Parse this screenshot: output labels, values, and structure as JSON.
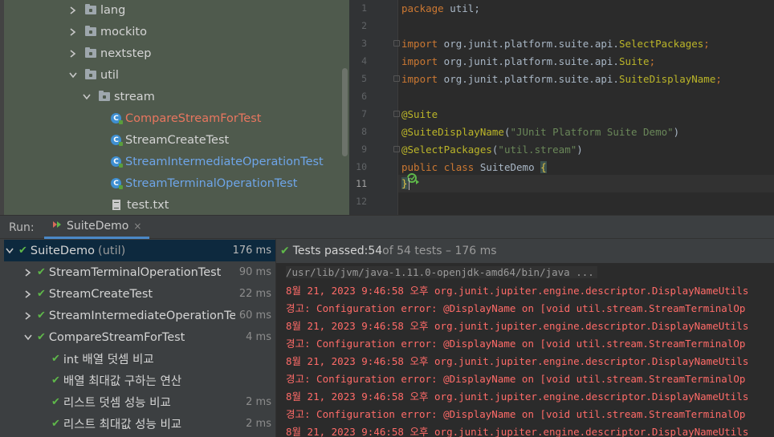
{
  "project_tree": {
    "items": [
      {
        "label": "lang",
        "type": "folder",
        "expanded": false
      },
      {
        "label": "mockito",
        "type": "folder",
        "expanded": false
      },
      {
        "label": "nextstep",
        "type": "folder",
        "expanded": false
      },
      {
        "label": "util",
        "type": "folder",
        "expanded": true
      },
      {
        "label": "stream",
        "type": "folder",
        "expanded": true
      },
      {
        "label": "CompareStreamForTest",
        "type": "class",
        "color": "#e8765f"
      },
      {
        "label": "StreamCreateTest",
        "type": "class",
        "color": "#d4d4d4"
      },
      {
        "label": "StreamIntermediateOperationTest",
        "type": "class",
        "color": "#6ea5e8"
      },
      {
        "label": "StreamTerminalOperationTest",
        "type": "class",
        "color": "#6ea5e8"
      },
      {
        "label": "test.txt",
        "type": "text-file"
      }
    ]
  },
  "editor": {
    "line_numbers": [
      "1",
      "2",
      "3",
      "4",
      "5",
      "6",
      "7",
      "8",
      "9",
      "10",
      "11",
      "12"
    ],
    "lines": {
      "l1": {
        "kw": "package",
        "rest": " util;"
      },
      "l3": {
        "kw": "import",
        "rest": " org.junit.platform.suite.api.",
        "cls": "SelectPackages",
        "end": ";"
      },
      "l4": {
        "kw": "import",
        "rest": " org.junit.platform.suite.api.",
        "cls": "Suite",
        "end": ";"
      },
      "l5": {
        "kw": "import",
        "rest": " org.junit.platform.suite.api.",
        "cls": "SuiteDisplayName",
        "end": ";"
      },
      "l7": {
        "ann": "@Suite"
      },
      "l8": {
        "ann": "@SuiteDisplayName",
        "open": "(",
        "str": "\"JUnit Platform Suite Demo\"",
        "close": ")"
      },
      "l9": {
        "ann": "@SelectPackages",
        "open": "(",
        "str": "\"util.stream\"",
        "close": ")"
      },
      "l10": {
        "kw1": "public",
        "kw2": "class",
        "name": "SuiteDemo",
        "brace": "{"
      },
      "l11": {
        "brace": "}"
      }
    },
    "current_line": "11"
  },
  "run_window": {
    "title": "Run:",
    "tab_label": "SuiteDemo",
    "tab_close": "×"
  },
  "test_tree": {
    "rows": [
      {
        "name": "SuiteDemo",
        "extra": "(util)",
        "time": "176 ms",
        "expand": "down",
        "selected": true
      },
      {
        "name": "StreamTerminalOperationTest",
        "time": "90 ms",
        "expand": "right"
      },
      {
        "name": "StreamCreateTest",
        "time": "22 ms",
        "expand": "right"
      },
      {
        "name": "StreamIntermediateOperationTe",
        "time": "60 ms",
        "expand": "right"
      },
      {
        "name": "CompareStreamForTest",
        "time": "4 ms",
        "expand": "down"
      },
      {
        "name": "int 배열 덧셈 비교",
        "time": ""
      },
      {
        "name": "배열 최대값 구하는 연산",
        "time": ""
      },
      {
        "name": "리스트 덧셈 성능 비교",
        "time": "2 ms"
      },
      {
        "name": "리스트 최대값 성능 비교",
        "time": "2 ms"
      }
    ]
  },
  "console": {
    "status": {
      "prefix": "Tests passed: ",
      "passed": "54",
      "of": " of 54 tests – 176 ms"
    },
    "command": "/usr/lib/jvm/java-1.11.0-openjdk-amd64/bin/java ...",
    "lines": [
      "8월 21, 2023 9:46:58 오후 org.junit.jupiter.engine.descriptor.DisplayNameUtils",
      "경고: Configuration error: @DisplayName on [void util.stream.StreamTerminalOp",
      "8월 21, 2023 9:46:58 오후 org.junit.jupiter.engine.descriptor.DisplayNameUtils",
      "경고: Configuration error: @DisplayName on [void util.stream.StreamTerminalOp",
      "8월 21, 2023 9:46:58 오후 org.junit.jupiter.engine.descriptor.DisplayNameUtils",
      "경고: Configuration error: @DisplayName on [void util.stream.StreamTerminalOp",
      "8월 21, 2023 9:46:58 오후 org.junit.jupiter.engine.descriptor.DisplayNameUtils",
      "경고: Configuration error: @DisplayName on [void util.stream.StreamTerminalOp",
      "8월 21, 2023 9:46:58 오후 org.junit.jupiter.engine.descriptor.DisplayNameUtils"
    ]
  },
  "colors": {
    "pass_green": "#5fb84a",
    "error_red": "#ff6b68",
    "selection_blue": "#0d293e",
    "tab_underline": "#4a88c7"
  }
}
